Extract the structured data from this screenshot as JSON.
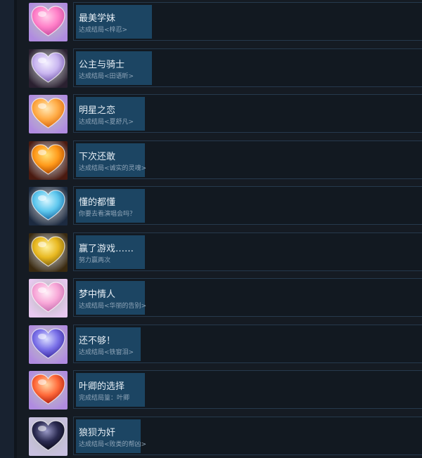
{
  "achievements": [
    {
      "title": "最美学妹",
      "desc": "达成结局<梓忍>",
      "icon": "pink-heart-icon",
      "colors": [
        "#ffd0ea",
        "#ff7fc8",
        "#c84fa0"
      ],
      "bg": "#b08be0"
    },
    {
      "title": "公主与骑士",
      "desc": "达成结局<田语昕>",
      "icon": "crystal-heart-icon",
      "colors": [
        "#f4f0ff",
        "#c9b6f0",
        "#7a5fb0"
      ],
      "bg": "#2a2030"
    },
    {
      "title": "明星之恋",
      "desc": "达成结局<夏舒凡>",
      "icon": "orange-heart-icon",
      "colors": [
        "#ffe9b8",
        "#ffab45",
        "#d86a12"
      ],
      "bg": "#b08be0"
    },
    {
      "title": "下次还敢",
      "desc": "达成结局<诚实的灵魂>",
      "icon": "amber-heart-icon",
      "colors": [
        "#ffe27a",
        "#ff9a1a",
        "#b04a00"
      ],
      "bg": "#4a1a10"
    },
    {
      "title": "懂的都懂",
      "desc": "你要去看演唱会吗？",
      "icon": "blue-heart-icon",
      "colors": [
        "#d8f6ff",
        "#5fc8ee",
        "#1b6fa8"
      ],
      "bg": "#1c2a40"
    },
    {
      "title": "赢了游戏……",
      "desc": "努力赢两次",
      "icon": "gold-heart-icon",
      "colors": [
        "#fff2a0",
        "#e8b820",
        "#8a6a10"
      ],
      "bg": "#3a2a10"
    },
    {
      "title": "梦中情人",
      "desc": "达成结局<华丽的告别>",
      "icon": "light-pink-heart-icon",
      "colors": [
        "#fff0f8",
        "#f8a8d8",
        "#c870b0"
      ],
      "bg": "#e8c8f0"
    },
    {
      "title": "还不够！",
      "desc": "达成结局<铁窗泪>",
      "icon": "violet-heart-icon",
      "colors": [
        "#dce0ff",
        "#7a70e8",
        "#3a2aa0"
      ],
      "bg": "#b08be0"
    },
    {
      "title": "叶卿的选择",
      "desc": "完成结局篁：叶卿",
      "icon": "red-orange-heart-icon",
      "colors": [
        "#ffd8a8",
        "#ff6a3a",
        "#b02010"
      ],
      "bg": "#b08be0"
    },
    {
      "title": "狼狈为奸",
      "desc": "达成结局<败类的帮凶>",
      "icon": "dark-heart-icon",
      "colors": [
        "#9a9ac8",
        "#2a2a50",
        "#0a0a18"
      ],
      "bg": "#c8c0e0"
    }
  ]
}
